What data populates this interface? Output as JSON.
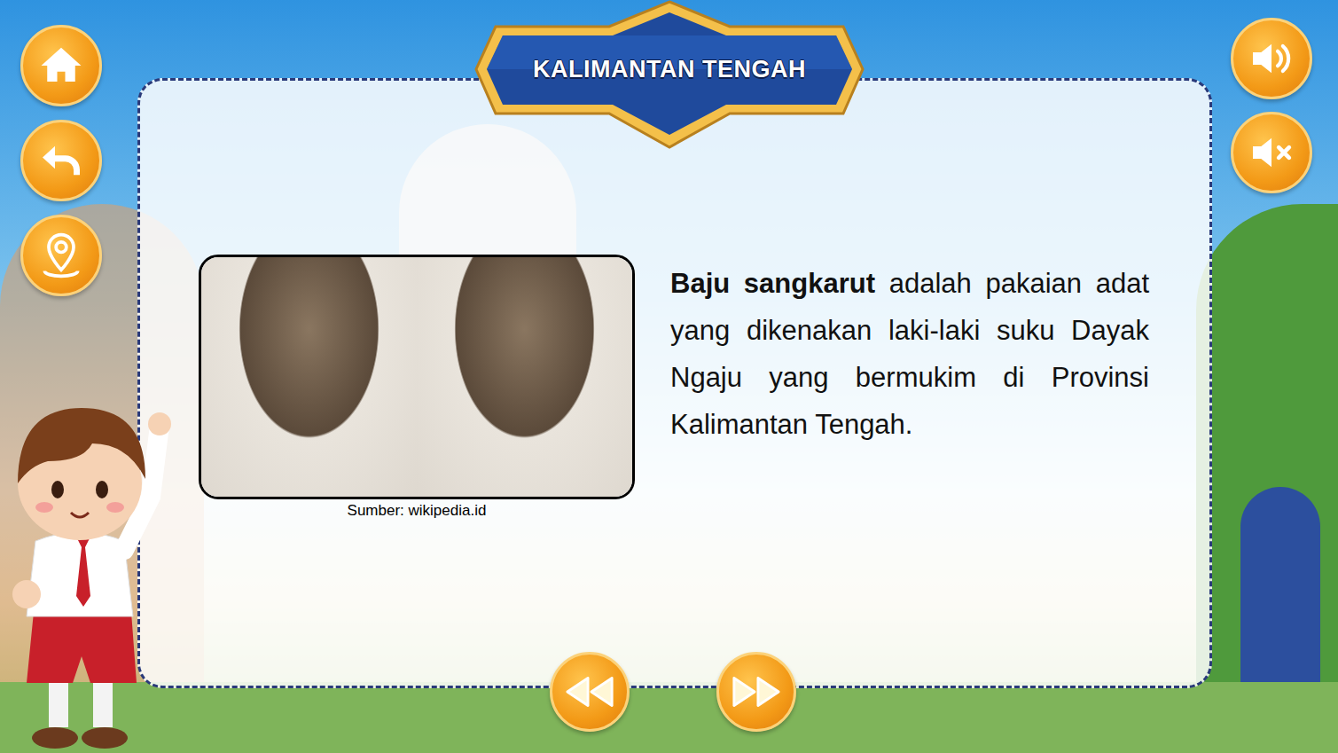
{
  "header": {
    "title": "KALIMANTAN TENGAH"
  },
  "photo": {
    "caption": "Sumber: wikipedia.id"
  },
  "description": {
    "term": "Baju sangkarut",
    "text": " adalah pakaian adat yang dikenakan laki-laki suku Dayak Ngaju yang bermukim di Provinsi Kalimantan Tengah."
  }
}
